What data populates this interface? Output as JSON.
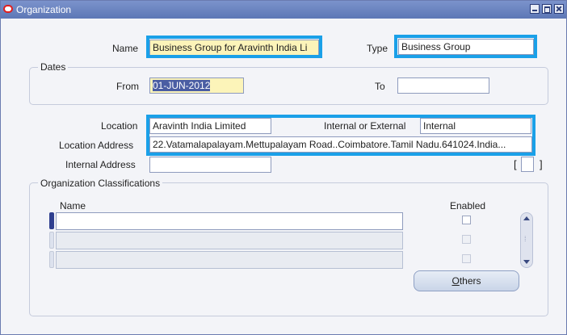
{
  "window": {
    "title": "Organization"
  },
  "header": {
    "name_label": "Name",
    "name_value": "Business Group for Aravinth India Li",
    "type_label": "Type",
    "type_value": "Business Group"
  },
  "dates": {
    "group_title": "Dates",
    "from_label": "From",
    "from_value": "01-JUN-2012",
    "to_label": "To",
    "to_value": ""
  },
  "location": {
    "location_label": "Location",
    "location_value": "Aravinth India Limited",
    "internal_external_label": "Internal or External",
    "internal_external_value": "Internal",
    "address_label": "Location Address",
    "address_value": "22.Vatamalapalayam.Mettupalayam Road..Coimbatore.Tamil Nadu.641024.India...",
    "internal_address_label": "Internal Address",
    "internal_address_value": "",
    "dff_open": "[",
    "dff_close": "]"
  },
  "classifications": {
    "group_title": "Organization Classifications",
    "name_header": "Name",
    "enabled_header": "Enabled",
    "rows": [
      {
        "name": "",
        "enabled": false
      },
      {
        "name": "",
        "enabled": false
      },
      {
        "name": "",
        "enabled": false
      }
    ],
    "others_button_mnemonic": "O",
    "others_button_rest": "thers"
  },
  "colors": {
    "titlebar": "#6b84c2",
    "highlight": "#1aa0e8",
    "required_field": "#fcf4b9"
  }
}
